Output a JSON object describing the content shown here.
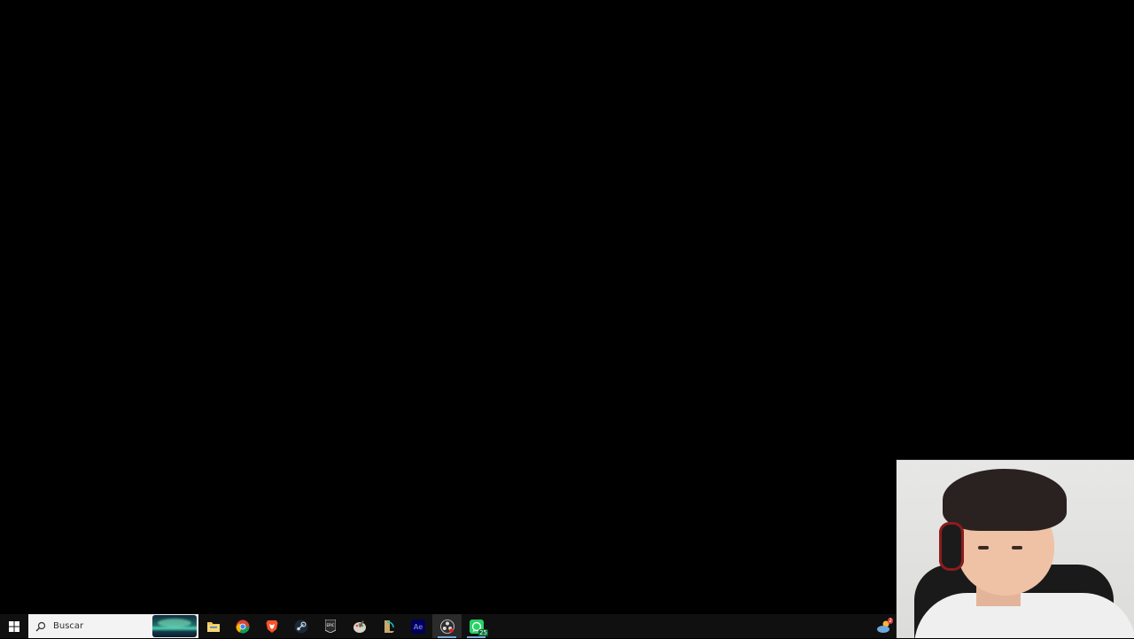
{
  "taskbar": {
    "search": {
      "placeholder": "Buscar"
    },
    "apps": [
      {
        "name": "file-explorer",
        "icon": "folder-icon",
        "running": false
      },
      {
        "name": "chrome",
        "icon": "chrome-icon",
        "running": false
      },
      {
        "name": "brave",
        "icon": "brave-icon",
        "running": false
      },
      {
        "name": "steam",
        "icon": "steam-icon",
        "running": false
      },
      {
        "name": "epic-games",
        "icon": "epic-games-icon",
        "running": false
      },
      {
        "name": "paint",
        "icon": "paint-icon",
        "running": false
      },
      {
        "name": "league-of-legends",
        "icon": "league-icon",
        "running": false
      },
      {
        "name": "after-effects",
        "icon": "after-effects-icon",
        "running": false
      },
      {
        "name": "obs-studio",
        "icon": "obs-icon",
        "running": true,
        "active": true
      },
      {
        "name": "whatsapp",
        "icon": "whatsapp-icon",
        "running": true,
        "badge": "25"
      }
    ],
    "after_effects_label": "Ae",
    "epic_label": "EPIC",
    "whatsapp_badge": "25",
    "weather_badge": "2"
  },
  "colors": {
    "taskbar_bg": "#101010",
    "desktop_bg": "#000000",
    "accent": "#7aa7d9"
  }
}
